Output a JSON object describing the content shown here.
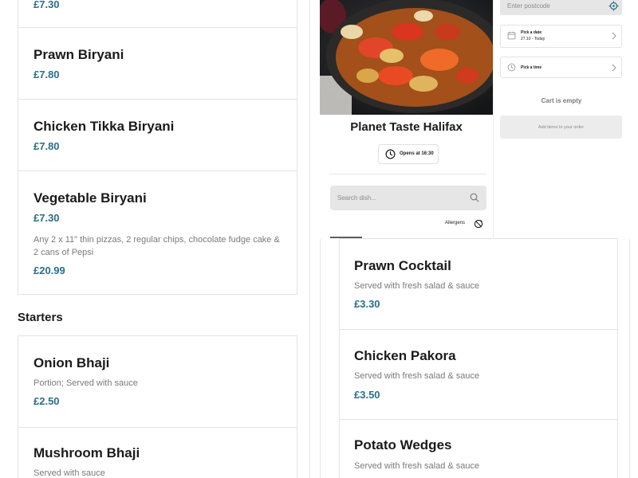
{
  "left_menu": {
    "items_top": [
      {
        "name": "Prawn Biryani",
        "price": "£7.80"
      },
      {
        "name": "Chicken Tikka Biryani",
        "price": "£7.80"
      },
      {
        "name": "Vegetable Biryani",
        "price": "£7.30"
      }
    ],
    "clipped_price_top": "£7.30",
    "partial_deal": {
      "description": "Any 2 x 11\" thin pizzas, 2 regular chips, chocolate fudge cake & 2 cans of Pepsi",
      "price": "£20.99"
    },
    "starters_title": "Starters",
    "starters": [
      {
        "name": "Onion Bhaji",
        "description": "Portion; Served with sauce",
        "price": "£2.50"
      },
      {
        "name": "Mushroom Bhaji",
        "description": "Served with sauce",
        "price": ""
      }
    ]
  },
  "restaurant": {
    "name": "Planet Taste Halifax",
    "opens_label": "Opens at 16:30",
    "search_placeholder": "Search dish...",
    "allergens_label": "Allergens"
  },
  "order": {
    "postcode_placeholder": "Enter postcode",
    "date_title": "Pick a date",
    "date_value": "27.10 - Today",
    "time_title": "Pick a time",
    "cart_status": "Cart is empty",
    "add_items_label": "Add items to your order"
  },
  "right_menu": {
    "items": [
      {
        "name": "Prawn Cocktail",
        "description": "Served with fresh salad & sauce",
        "price": "£3.30"
      },
      {
        "name": "Chicken Pakora",
        "description": "Served with fresh salad & sauce",
        "price": "£3.50"
      },
      {
        "name": "Potato Wedges",
        "description": "Served with fresh salad & sauce",
        "price": ""
      }
    ]
  },
  "colors": {
    "price": "#2a6f86",
    "card_border": "#e3e3e3",
    "input_bg": "#e6e6e6"
  },
  "icons": [
    "clock-icon",
    "search-icon",
    "allergen-icon",
    "locate-icon",
    "calendar-icon",
    "chevron-right-icon"
  ]
}
